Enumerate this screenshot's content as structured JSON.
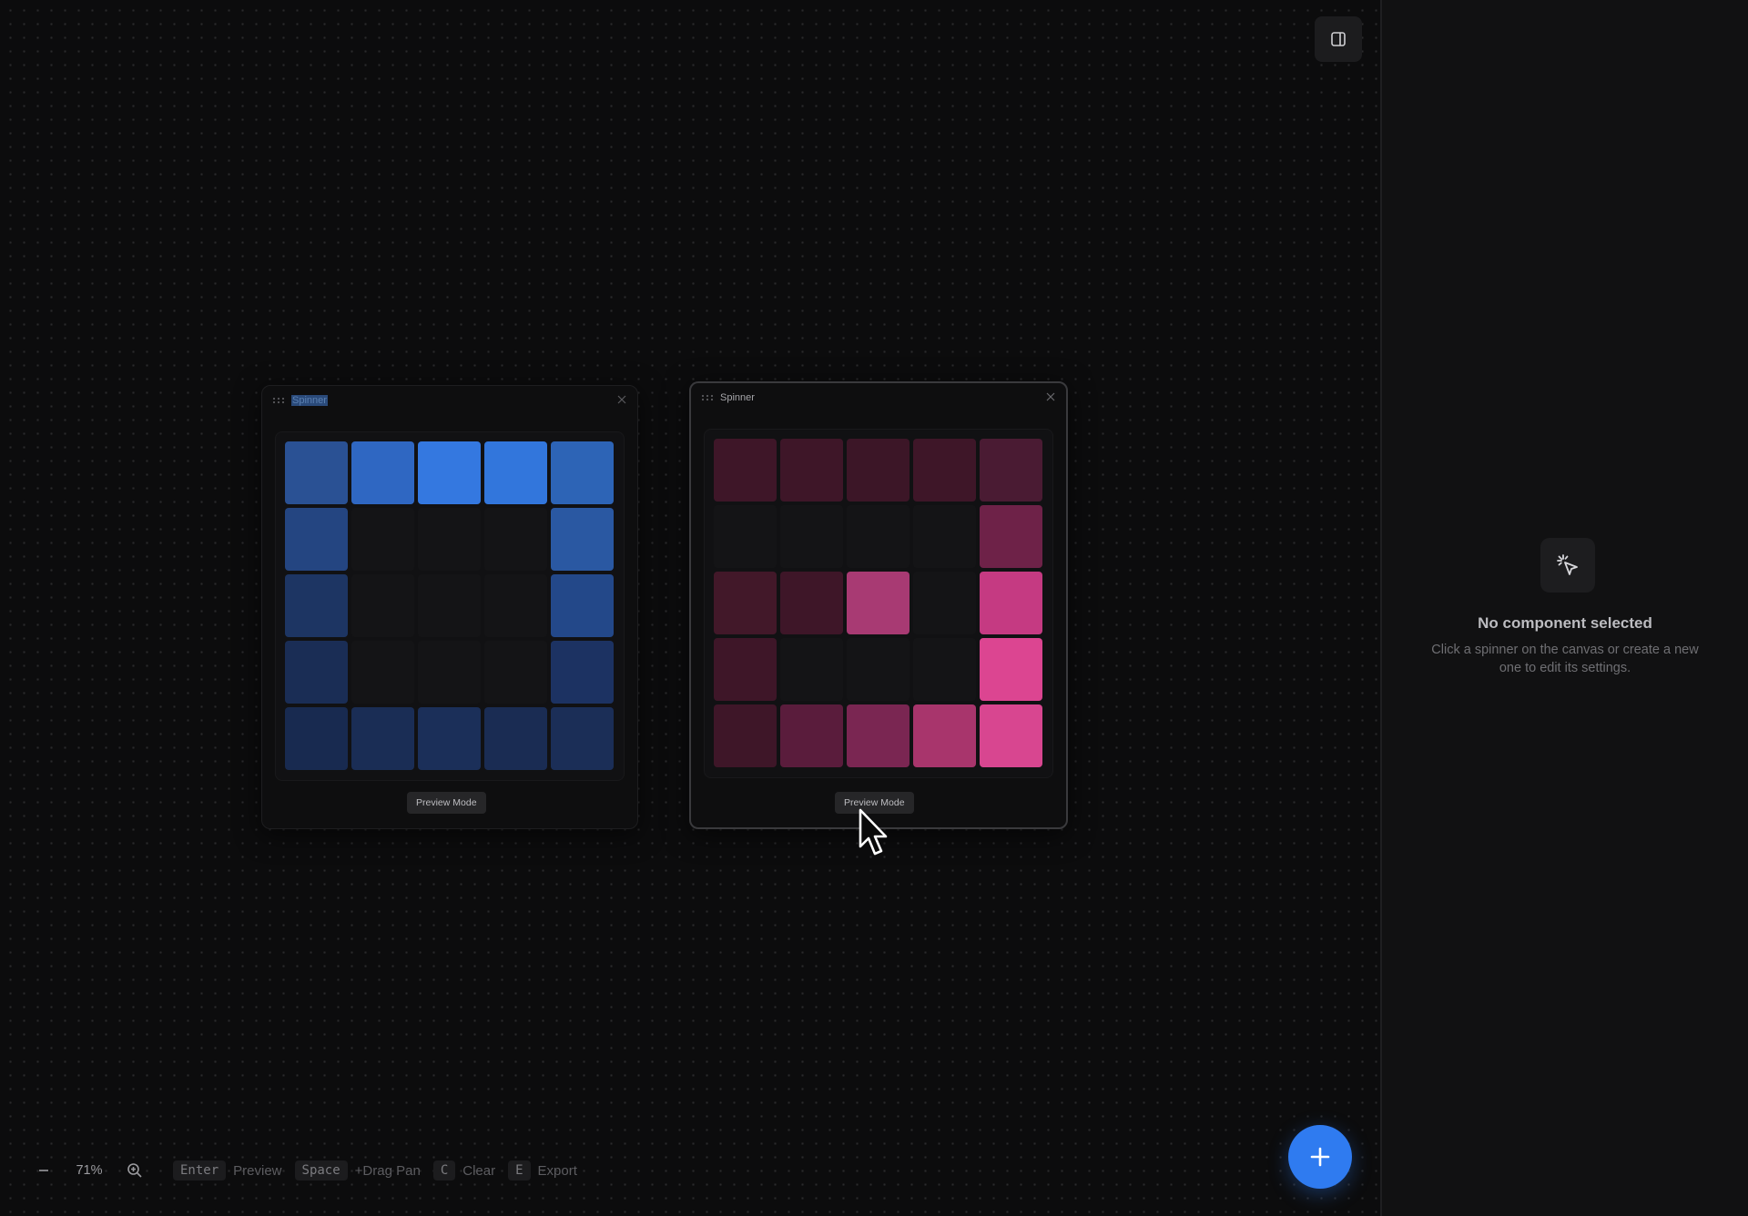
{
  "header": {
    "toggle_panel_icon": "panel-right-icon"
  },
  "spinners": [
    {
      "title": "Spinner",
      "title_selected_text": true,
      "close_icon": "close-icon",
      "preview_label": "Preview Mode",
      "colors": [
        [
          "#2a5194",
          "#2f67c2",
          "#3478e0",
          "#3276dc",
          "#2d64b6"
        ],
        [
          "#244581",
          null,
          null,
          null,
          "#2a58a2"
        ],
        [
          "#1d3563",
          null,
          null,
          null,
          "#234889"
        ],
        [
          "#1a2d55",
          null,
          null,
          null,
          "#1c3262"
        ],
        [
          "#182a50",
          "#1a2d55",
          "#1b2f59",
          "#1a2c53",
          "#1b2e57"
        ]
      ]
    },
    {
      "title": "Spinner",
      "close_icon": "close-icon",
      "preview_label": "Preview Mode",
      "colors": [
        [
          "#3e1628",
          "#3e1628",
          "#3c1627",
          "#3e1628",
          "#4a1b33"
        ],
        [
          null,
          null,
          null,
          null,
          "#6e2248"
        ],
        [
          "#421829",
          "#3e1628",
          "#a83a73",
          null,
          "#c53a82"
        ],
        [
          "#3e1628",
          null,
          null,
          null,
          "#dc4591"
        ],
        [
          "#3e1628",
          "#5a1c3c",
          "#7a2652",
          "#a8356c",
          "#d84690"
        ]
      ]
    }
  ],
  "sidebar": {
    "empty_icon": "cursor-click-icon",
    "empty_title": "No component selected",
    "empty_description": "Click a spinner on the canvas or create a new one to edit its settings."
  },
  "fab": {
    "icon": "plus-icon"
  },
  "toolbar": {
    "zoom_out_icon": "minus-icon",
    "zoom_level": "71%",
    "zoom_in_icon": "zoom-in-icon",
    "shortcuts": [
      {
        "key": "Enter",
        "label": "Preview"
      },
      {
        "key": "Space",
        "label": "+Drag Pan"
      },
      {
        "key": "C",
        "label": "Clear"
      },
      {
        "key": "E",
        "label": "Export"
      }
    ]
  }
}
